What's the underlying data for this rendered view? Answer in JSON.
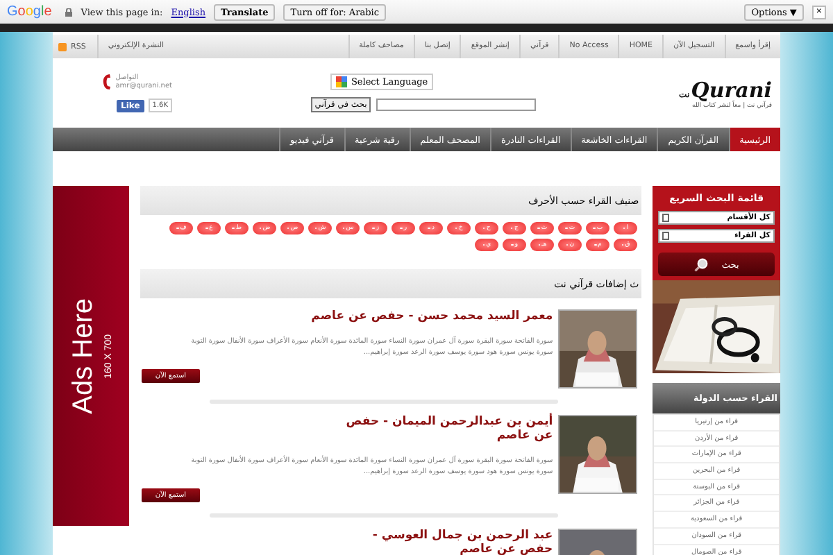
{
  "translate_bar": {
    "brand": "Google",
    "prompt": "View this page in:",
    "language": "English",
    "translate_button": "Translate",
    "turn_off_button": "Turn off for: Arabic",
    "options_button": "Options ▼",
    "close": "×"
  },
  "top_nav": {
    "items": [
      "إقرأ واسمع",
      "التسجيل الآن",
      "HOME",
      "No Access",
      "قرآني",
      "إنشر الموقع",
      "إتصل بنا",
      "مصاحف كاملة"
    ],
    "rss": "RSS",
    "newsletter": "النشرة الإلكتروني"
  },
  "header": {
    "logo": "Qurani",
    "logo_suffix": "نت",
    "tagline": "قرآني نت | معاً لنشر كتاب الله",
    "language_select": "Select Language",
    "search_button": "بحث في قرآني",
    "contact_label": "التواصل",
    "contact_email": "amr@qurani.net",
    "like": "Like",
    "like_count": "1.6K"
  },
  "main_nav": [
    {
      "label": "الرئيسية",
      "selected": true
    },
    {
      "label": "القرآن الكريم",
      "selected": false
    },
    {
      "label": "القراءات الخاشعة",
      "selected": false
    },
    {
      "label": "القراءات النادرة",
      "selected": false
    },
    {
      "label": "المصحف المعلم",
      "selected": false
    },
    {
      "label": "رقية شرعية",
      "selected": false
    },
    {
      "label": "قرآني فيديو",
      "selected": false
    }
  ],
  "quick_search": {
    "title": "قائمة البحث السريع",
    "selects": [
      "كل الأقسام",
      "كل القراء"
    ],
    "button": "بحث"
  },
  "countries": {
    "title": "القراء حسب الدولة",
    "items": [
      "قراء من إرتيريا",
      "قراء من الأردن",
      "قراء من الإمارات",
      "قراء من البحرين",
      "قراء من البوسنة",
      "قراء من الجزائر",
      "قراء من السعودية",
      "قراء من السودان",
      "قراء من الصومال"
    ]
  },
  "letters": {
    "title": "صنيف القراء حسب الأحرف",
    "items": [
      "ا",
      "ب",
      "ت",
      "ث",
      "ج",
      "ح",
      "خ",
      "د",
      "ر",
      "ز",
      "س",
      "ش",
      "ص",
      "ض",
      "ط",
      "ع",
      "ف",
      "ق",
      "م",
      "ن",
      "هـ",
      "و",
      "ي"
    ]
  },
  "latest": {
    "title": "ث إضافات قرآني نت",
    "items": [
      {
        "title": "معمر السيد محمد حسن - حفص عن عاصم",
        "description": "سورة الفاتحة سورة البقرة سورة آل عمران سورة النساء سورة المائدة سورة الأنعام سورة الأعراف سورة الأنفال سورة التوبة سورة يونس سورة هود سورة يوسف سورة الرعد سورة إبراهيم...",
        "button": "استمع الآن"
      },
      {
        "title": "أيمن بن عبدالرحمن الميمان - حفص عن عاصم",
        "description": "سورة الفاتحة سورة البقرة سورة آل عمران سورة النساء سورة المائدة سورة الأنعام سورة الأعراف سورة الأنفال سورة التوبة سورة يونس سورة هود سورة يوسف سورة الرعد سورة إبراهيم...",
        "button": "استمع الآن"
      },
      {
        "title": "عبد الرحمن بن جمال العوسي - حفص عن عاصم"
      }
    ]
  },
  "ad": {
    "title": "Ads Here",
    "size": "160 X 700"
  }
}
